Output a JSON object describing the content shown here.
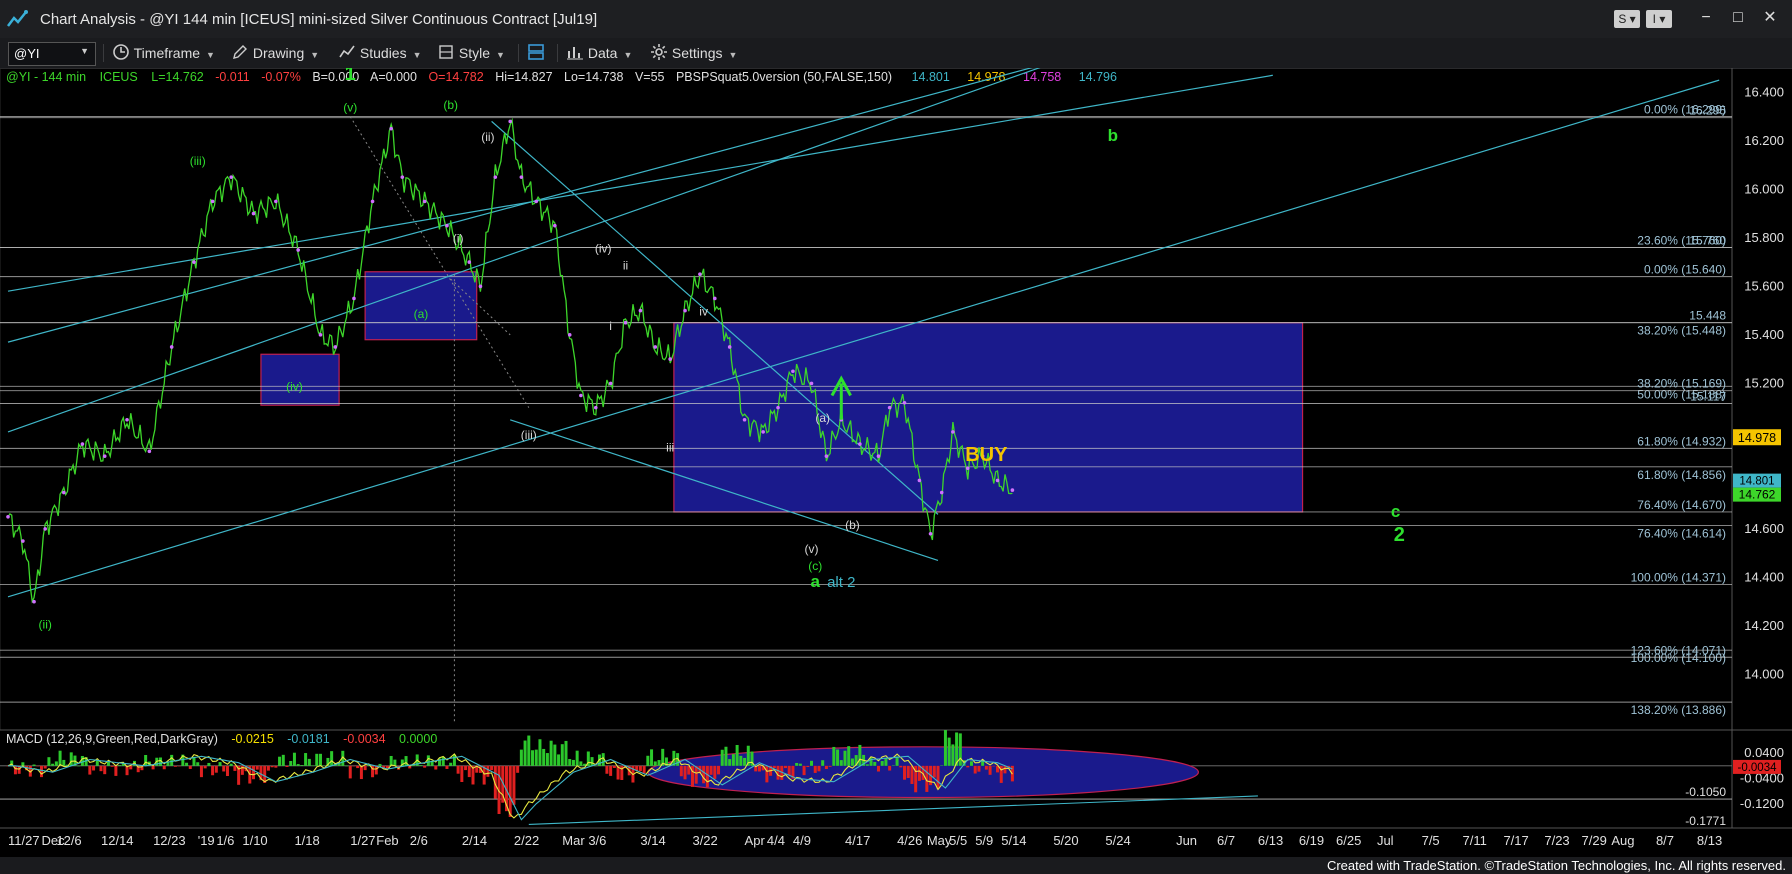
{
  "window": {
    "title": "Chart Analysis - @YI 144 min [ICEUS] mini-sized Silver Continuous Contract [Jul19]",
    "s_button": "S",
    "i_button": "I",
    "minimize": "−",
    "maximize": "□",
    "close": "✕"
  },
  "toolbar": {
    "symbol": "@YI",
    "timeframe": "Timeframe",
    "drawing": "Drawing",
    "studies": "Studies",
    "style": "Style",
    "data": "Data",
    "settings": "Settings"
  },
  "header": {
    "symbol": "@YI - 144 min",
    "exchange": "ICEUS",
    "last": "L=14.762",
    "change": "-0.011",
    "pct": "-0.07%",
    "bid": "B=0.000",
    "ask": "A=0.000",
    "open": "O=14.782",
    "high": "Hi=14.827",
    "low": "Lo=14.738",
    "volume": "V=55",
    "study": "PBSPSquat5.0version (50,FALSE,150)",
    "sv1": "14.801",
    "sv2": "14.978",
    "sv3": "14.758",
    "sv4": "14.796"
  },
  "macd_header": {
    "label": "MACD (12,26,9,Green,Red,DarkGray)",
    "v1": "-0.0215",
    "v2": "-0.0181",
    "v3": "-0.0034",
    "v4": "0.0000"
  },
  "footer": "Created with TradeStation. ©TradeStation Technologies, Inc. All rights reserved.",
  "colors": {
    "background": "#000000",
    "price": "#3dd62a",
    "channel": "#3fb6c8",
    "box": "#1a1a8c",
    "box_border": "#c02050",
    "label_green": "#2ee02e",
    "label_white": "#d8d8d8",
    "buy": "#f5c400"
  },
  "chart_data": {
    "type": "line",
    "price_axis": {
      "ylim": [
        13.8,
        16.5
      ],
      "ticks": [
        "16.400",
        "16.200",
        "16.000",
        "15.800",
        "15.600",
        "15.400",
        "15.200",
        "14.600",
        "14.400",
        "14.200",
        "14.000"
      ],
      "tick_values": [
        16.4,
        16.2,
        16.0,
        15.8,
        15.6,
        15.4,
        15.2,
        14.6,
        14.4,
        14.2,
        14.0
      ],
      "last_price_tag": "14.978",
      "last_price_value": 14.978,
      "tag_2": "14.801",
      "tag_3": "14.762",
      "tag_3_value": 14.762
    },
    "macd_axis": {
      "ylim": [
        -0.19,
        0.05
      ],
      "ticks": [
        "0.0400",
        "-0.0400",
        "-0.1200"
      ],
      "tick_values": [
        0.04,
        -0.04,
        -0.12
      ],
      "tag_1": "-0.0034",
      "tag_1_value": -0.0034
    },
    "x_ticks": [
      "11/27",
      "Dec",
      "12/6",
      "12/14",
      "12/23",
      "'19",
      "1/6",
      "1/10",
      "1/18",
      "1/27",
      "Feb",
      "2/6",
      "2/14",
      "2/22",
      "Mar",
      "3/6",
      "3/14",
      "3/22",
      "Apr",
      "4/4",
      "4/9",
      "4/17",
      "4/26",
      "May",
      "5/5",
      "5/9",
      "5/14",
      "5/20",
      "5/24",
      "Jun",
      "6/7",
      "6/13",
      "6/19",
      "6/25",
      "Jul",
      "7/5",
      "7/11",
      "7/17",
      "7/23",
      "7/29",
      "Aug",
      "8/7",
      "8/13"
    ],
    "x_tick_index": [
      0,
      9,
      13,
      25,
      39,
      51,
      56,
      63,
      77,
      92,
      99,
      108,
      122,
      136,
      149,
      156,
      170,
      184,
      198,
      204,
      211,
      225,
      239,
      247,
      253,
      260,
      267,
      281,
      295,
      314,
      325,
      336,
      347,
      357,
      368,
      380,
      391,
      402,
      413,
      423,
      431,
      443,
      454
    ],
    "price_series": {
      "name": "@YI 144 min",
      "anchors": [
        [
          0,
          14.65
        ],
        [
          4,
          14.55
        ],
        [
          7,
          14.3
        ],
        [
          10,
          14.6
        ],
        [
          15,
          14.75
        ],
        [
          20,
          14.95
        ],
        [
          26,
          14.9
        ],
        [
          32,
          15.05
        ],
        [
          38,
          14.92
        ],
        [
          44,
          15.35
        ],
        [
          50,
          15.7
        ],
        [
          55,
          15.95
        ],
        [
          60,
          16.05
        ],
        [
          66,
          15.9
        ],
        [
          72,
          15.95
        ],
        [
          78,
          15.75
        ],
        [
          84,
          15.4
        ],
        [
          88,
          15.35
        ],
        [
          93,
          15.55
        ],
        [
          98,
          15.95
        ],
        [
          103,
          16.25
        ],
        [
          106,
          16.05
        ],
        [
          112,
          15.95
        ],
        [
          118,
          15.85
        ],
        [
          124,
          15.7
        ],
        [
          127,
          15.6
        ],
        [
          131,
          16.05
        ],
        [
          135,
          16.28
        ],
        [
          138,
          16.05
        ],
        [
          142,
          15.95
        ],
        [
          147,
          15.85
        ],
        [
          151,
          15.4
        ],
        [
          154,
          15.15
        ],
        [
          158,
          15.1
        ],
        [
          162,
          15.2
        ],
        [
          166,
          15.45
        ],
        [
          170,
          15.5
        ],
        [
          174,
          15.35
        ],
        [
          178,
          15.3
        ],
        [
          182,
          15.5
        ],
        [
          186,
          15.65
        ],
        [
          190,
          15.55
        ],
        [
          194,
          15.35
        ],
        [
          198,
          15.05
        ],
        [
          203,
          15.0
        ],
        [
          207,
          15.1
        ],
        [
          211,
          15.25
        ],
        [
          216,
          15.2
        ],
        [
          220,
          14.9
        ],
        [
          224,
          15.05
        ],
        [
          229,
          14.95
        ],
        [
          234,
          14.9
        ],
        [
          237,
          15.1
        ],
        [
          241,
          15.12
        ],
        [
          245,
          14.8
        ],
        [
          248,
          14.58
        ],
        [
          251,
          14.75
        ],
        [
          254,
          15.0
        ],
        [
          258,
          14.85
        ],
        [
          262,
          14.9
        ],
        [
          266,
          14.8
        ],
        [
          270,
          14.76
        ]
      ]
    },
    "horizontal_levels": [
      {
        "label": "0.00% (16.299)",
        "value": 16.3
      },
      {
        "label": "16.295",
        "value": 16.295
      },
      {
        "label": "23.60% (15.760)",
        "value": 15.76
      },
      {
        "label": "15.760",
        "value": 15.76
      },
      {
        "label": "0.00% (15.640)",
        "value": 15.64
      },
      {
        "label": "38.20% (15.448)",
        "value": 15.45
      },
      {
        "label": "15.448",
        "value": 15.45
      },
      {
        "label": "50.00% (15.188)",
        "value": 15.188
      },
      {
        "label": "38.20% (15.169)",
        "value": 15.17
      },
      {
        "label": "15.117",
        "value": 15.117
      },
      {
        "label": "61.80% (14.932)",
        "value": 14.932
      },
      {
        "label": "61.80% (14.856)",
        "value": 14.856
      },
      {
        "label": "76.40% (14.670)",
        "value": 14.67
      },
      {
        "label": "76.40% (14.614)",
        "value": 14.614
      },
      {
        "label": "100.00% (14.371)",
        "value": 14.371
      },
      {
        "label": "100.00% (14.100)",
        "value": 14.1
      },
      {
        "label": "123.60% (14.071)",
        "value": 14.071
      },
      {
        "label": "138.20% (13.886)",
        "value": 13.886
      }
    ],
    "wave_labels": [
      {
        "text": "1",
        "x": 92,
        "y": 16.45
      },
      {
        "text": "(v)",
        "x": 92,
        "y": 16.32
      },
      {
        "text": "(iii)",
        "x": 51,
        "y": 16.1
      },
      {
        "text": "(iv)",
        "x": 77,
        "y": 15.17
      },
      {
        "text": "(ii)",
        "x": 10,
        "y": 14.19
      },
      {
        "text": "(b)",
        "x": 119,
        "y": 16.33
      },
      {
        "text": "(ii)",
        "x": 129,
        "y": 16.2
      },
      {
        "text": "(i)",
        "x": 121,
        "y": 15.78
      },
      {
        "text": "(a)",
        "x": 111,
        "y": 15.47
      },
      {
        "text": "(iii)",
        "x": 140,
        "y": 14.97
      },
      {
        "text": "(iv)",
        "x": 160,
        "y": 15.74
      },
      {
        "text": "ii",
        "x": 166,
        "y": 15.67
      },
      {
        "text": "i",
        "x": 162,
        "y": 15.42
      },
      {
        "text": "iv",
        "x": 187,
        "y": 15.48
      },
      {
        "text": "iii",
        "x": 178,
        "y": 14.92
      },
      {
        "text": "(a)",
        "x": 219,
        "y": 15.04
      },
      {
        "text": "(b)",
        "x": 227,
        "y": 14.6
      },
      {
        "text": "(v)",
        "x": 216,
        "y": 14.5
      },
      {
        "text": "(c)",
        "x": 217,
        "y": 14.43
      },
      {
        "text": "a",
        "x": 217,
        "y": 14.36
      },
      {
        "text": "alt 2",
        "x": 224,
        "y": 14.36
      },
      {
        "text": "b",
        "x": 297,
        "y": 16.2
      },
      {
        "text": "c",
        "x": 373,
        "y": 14.65
      },
      {
        "text": "2",
        "x": 374,
        "y": 14.55
      }
    ],
    "buy_label": "BUY",
    "boxes": [
      {
        "name": "target-box-main",
        "x0": 179,
        "x1": 348,
        "y0": 14.67,
        "y1": 15.45
      },
      {
        "name": "box-feb",
        "x0": 96,
        "x1": 126,
        "y0": 15.38,
        "y1": 15.66
      },
      {
        "name": "box-jan",
        "x0": 68,
        "x1": 89,
        "y0": 15.11,
        "y1": 15.32
      }
    ],
    "macd_series": {
      "name": "MACD",
      "anchors": [
        [
          0,
          0.0
        ],
        [
          10,
          -0.02
        ],
        [
          20,
          0.02
        ],
        [
          35,
          0.0
        ],
        [
          50,
          0.03
        ],
        [
          60,
          0.01
        ],
        [
          70,
          -0.05
        ],
        [
          80,
          -0.02
        ],
        [
          90,
          0.02
        ],
        [
          100,
          -0.01
        ],
        [
          110,
          0.01
        ],
        [
          120,
          0.03
        ],
        [
          130,
          -0.03
        ],
        [
          136,
          -0.17
        ],
        [
          140,
          -0.12
        ],
        [
          150,
          -0.02
        ],
        [
          160,
          0.02
        ],
        [
          170,
          -0.03
        ],
        [
          180,
          0.02
        ],
        [
          190,
          -0.06
        ],
        [
          200,
          0.01
        ],
        [
          210,
          -0.04
        ],
        [
          220,
          -0.05
        ],
        [
          230,
          0.02
        ],
        [
          240,
          0.03
        ],
        [
          250,
          -0.07
        ],
        [
          256,
          0.02
        ],
        [
          264,
          0.01
        ],
        [
          270,
          -0.02
        ]
      ]
    }
  }
}
